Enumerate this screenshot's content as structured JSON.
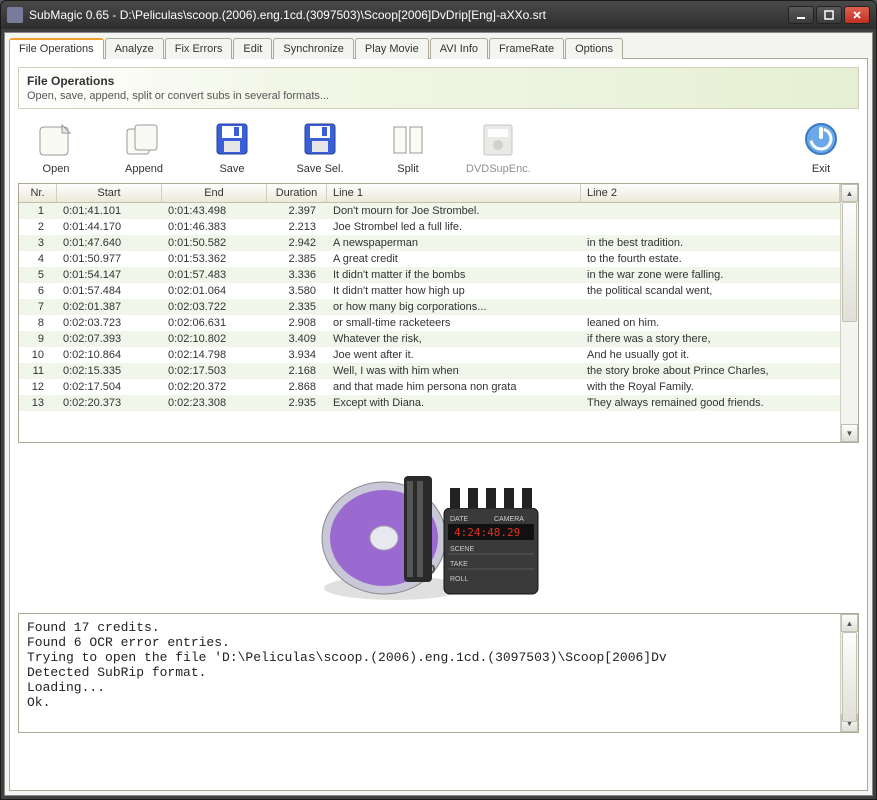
{
  "window": {
    "title": "SubMagic 0.65 - D:\\Peliculas\\scoop.(2006).eng.1cd.(3097503)\\Scoop[2006]DvDrip[Eng]-aXXo.srt"
  },
  "tabs": [
    "File Operations",
    "Analyze",
    "Fix Errors",
    "Edit",
    "Synchronize",
    "Play Movie",
    "AVI Info",
    "FrameRate",
    "Options"
  ],
  "section": {
    "title": "File Operations",
    "desc": "Open, save, append, split or convert subs in several formats..."
  },
  "toolbar": {
    "open": "Open",
    "append": "Append",
    "save": "Save",
    "savesel": "Save Sel.",
    "split": "Split",
    "dvdsupenc": "DVDSupEnc.",
    "exit": "Exit"
  },
  "grid": {
    "headers": {
      "nr": "Nr.",
      "start": "Start",
      "end": "End",
      "dur": "Duration",
      "l1": "Line 1",
      "l2": "Line 2"
    },
    "rows": [
      {
        "nr": "1",
        "start": "0:01:41.101",
        "end": "0:01:43.498",
        "dur": "2.397",
        "l1": "Don't mourn for Joe Strombel.",
        "l2": ""
      },
      {
        "nr": "2",
        "start": "0:01:44.170",
        "end": "0:01:46.383",
        "dur": "2.213",
        "l1": "Joe Strombel led a full life.",
        "l2": ""
      },
      {
        "nr": "3",
        "start": "0:01:47.640",
        "end": "0:01:50.582",
        "dur": "2.942",
        "l1": "A newspaperman",
        "l2": "in the best tradition."
      },
      {
        "nr": "4",
        "start": "0:01:50.977",
        "end": "0:01:53.362",
        "dur": "2.385",
        "l1": "A great credit",
        "l2": "to the fourth estate."
      },
      {
        "nr": "5",
        "start": "0:01:54.147",
        "end": "0:01:57.483",
        "dur": "3.336",
        "l1": "It didn't matter if the bombs",
        "l2": "in the war zone were falling."
      },
      {
        "nr": "6",
        "start": "0:01:57.484",
        "end": "0:02:01.064",
        "dur": "3.580",
        "l1": "It didn't matter how high up",
        "l2": "the political scandal went,"
      },
      {
        "nr": "7",
        "start": "0:02:01.387",
        "end": "0:02:03.722",
        "dur": "2.335",
        "l1": "or how many big corporations...",
        "l2": ""
      },
      {
        "nr": "8",
        "start": "0:02:03.723",
        "end": "0:02:06.631",
        "dur": "2.908",
        "l1": "or small-time racketeers",
        "l2": "leaned on him."
      },
      {
        "nr": "9",
        "start": "0:02:07.393",
        "end": "0:02:10.802",
        "dur": "3.409",
        "l1": "Whatever the risk,",
        "l2": "if there was a story there,"
      },
      {
        "nr": "10",
        "start": "0:02:10.864",
        "end": "0:02:14.798",
        "dur": "3.934",
        "l1": "Joe went after it.",
        "l2": "And he usually got it."
      },
      {
        "nr": "11",
        "start": "0:02:15.335",
        "end": "0:02:17.503",
        "dur": "2.168",
        "l1": "Well, I was with him when",
        "l2": "the story broke about Prince Charles,"
      },
      {
        "nr": "12",
        "start": "0:02:17.504",
        "end": "0:02:20.372",
        "dur": "2.868",
        "l1": "and that made him persona non grata",
        "l2": "with the Royal Family."
      },
      {
        "nr": "13",
        "start": "0:02:20.373",
        "end": "0:02:23.308",
        "dur": "2.935",
        "l1": "Except with Diana.",
        "l2": "They always remained good friends."
      }
    ]
  },
  "log": {
    "lines": [
      "Found 17 credits.",
      "Found 6 OCR error entries.",
      "Trying to open the file 'D:\\Peliculas\\scoop.(2006).eng.1cd.(3097503)\\Scoop[2006]Dv",
      "Detected SubRip format.",
      "Loading...",
      "Ok."
    ]
  }
}
